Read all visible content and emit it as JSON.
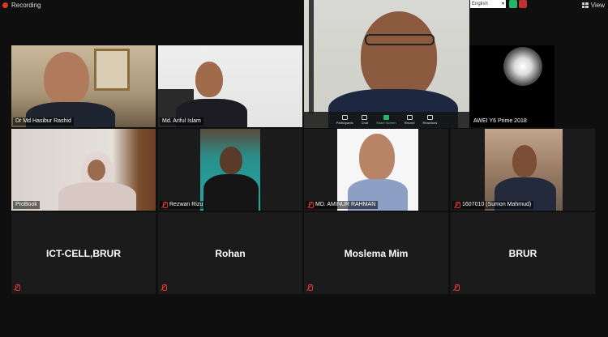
{
  "topbar": {
    "recording_label": "Recording",
    "view_label": "View",
    "language_value": "English"
  },
  "active_speaker": {
    "toolbar": [
      {
        "label": "Participants"
      },
      {
        "label": "Chat"
      },
      {
        "label": "Share Screen"
      },
      {
        "label": "Record"
      },
      {
        "label": "Reactions"
      }
    ]
  },
  "tiles": [
    {
      "name": "Dr Md Hasibur Rashid",
      "muted": false
    },
    {
      "name": "Md. Ariful Islam",
      "muted": false
    },
    {
      "name": "AWEI Y6 Prime 2018",
      "muted": false
    },
    {
      "name": "ProBook",
      "muted": false
    },
    {
      "name": "Rezwan Rizu",
      "muted": true
    },
    {
      "name": "MD. AMINUR RAHMAN",
      "muted": true
    },
    {
      "name": "1607010 (Sumon Mahmud)",
      "muted": true
    },
    {
      "name": "ICT-CELL,BRUR",
      "muted": true
    },
    {
      "name": "Rohan",
      "muted": true
    },
    {
      "name": "Moslema Mim",
      "muted": true
    },
    {
      "name": "BRUR",
      "muted": true
    }
  ],
  "colors": {
    "background": "#0f0f0f",
    "tile": "#1b1b1b",
    "recording": "#e0342f",
    "share_green": "#26b36b"
  }
}
